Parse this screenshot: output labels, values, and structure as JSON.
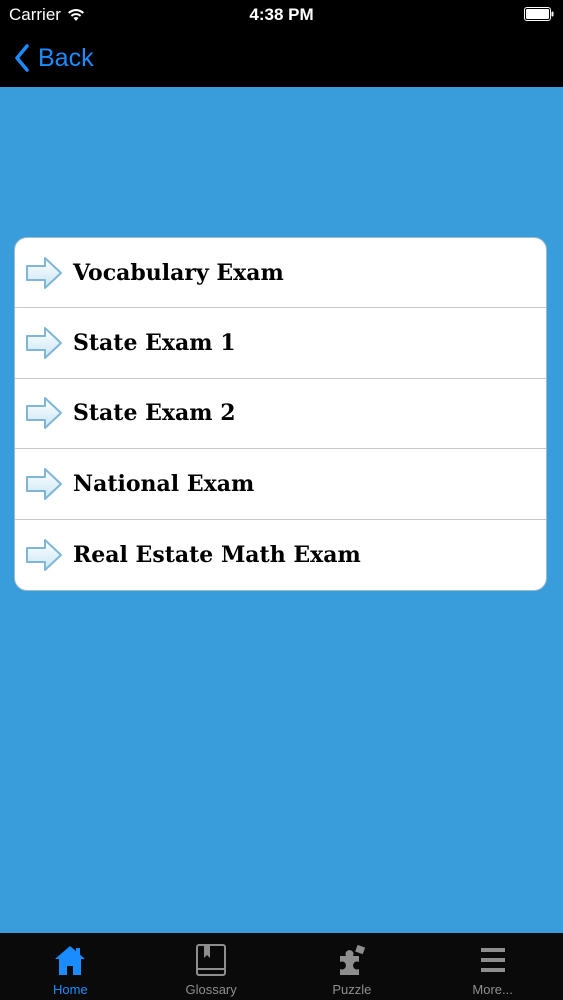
{
  "status_bar": {
    "carrier": "Carrier",
    "time": "4:38 PM"
  },
  "nav": {
    "back_label": "Back"
  },
  "menu": {
    "items": [
      {
        "label": "Vocabulary Exam"
      },
      {
        "label": "State Exam 1"
      },
      {
        "label": "State Exam 2"
      },
      {
        "label": "National Exam"
      },
      {
        "label": "Real Estate Math Exam"
      }
    ]
  },
  "tabs": [
    {
      "label": "Home",
      "icon": "home-icon",
      "active": true
    },
    {
      "label": "Glossary",
      "icon": "book-icon",
      "active": false
    },
    {
      "label": "Puzzle",
      "icon": "puzzle-icon",
      "active": false
    },
    {
      "label": "More...",
      "icon": "menu-lines-icon",
      "active": false
    }
  ],
  "colors": {
    "background": "#3a9ddb",
    "accent": "#1a8cff",
    "bars": "#000000",
    "inactive_tab": "#8e8e8e"
  }
}
